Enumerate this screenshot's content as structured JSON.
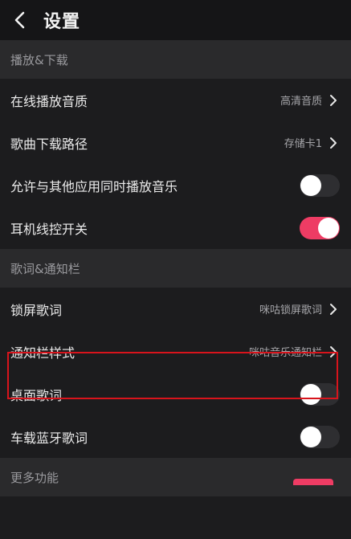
{
  "header": {
    "title": "设置"
  },
  "sections": [
    {
      "title": "播放&下载",
      "rows": [
        {
          "label": "在线播放音质",
          "kind": "nav",
          "value": "高清音质"
        },
        {
          "label": "歌曲下载路径",
          "kind": "nav",
          "value": "存储卡1"
        },
        {
          "label": "允许与其他应用同时播放音乐",
          "kind": "toggle",
          "on": false
        },
        {
          "label": "耳机线控开关",
          "kind": "toggle",
          "on": true
        }
      ]
    },
    {
      "title": "歌词&通知栏",
      "rows": [
        {
          "label": "锁屏歌词",
          "kind": "nav",
          "value": "咪咕锁屏歌词"
        },
        {
          "label": "通知栏样式",
          "kind": "nav",
          "value": "咪咕音乐通知栏"
        },
        {
          "label": "桌面歌词",
          "kind": "toggle",
          "on": false
        },
        {
          "label": "车载蓝牙歌词",
          "kind": "toggle",
          "on": false
        }
      ]
    },
    {
      "title": "更多功能",
      "rows": []
    }
  ],
  "colors": {
    "accent": "#ee3c64",
    "highlight_border": "#d8141c",
    "background": "#1c1c1e",
    "section_bg": "#2a2a2c"
  },
  "icons": {
    "back": "chevron-left-icon",
    "nav": "chevron-right-icon"
  }
}
